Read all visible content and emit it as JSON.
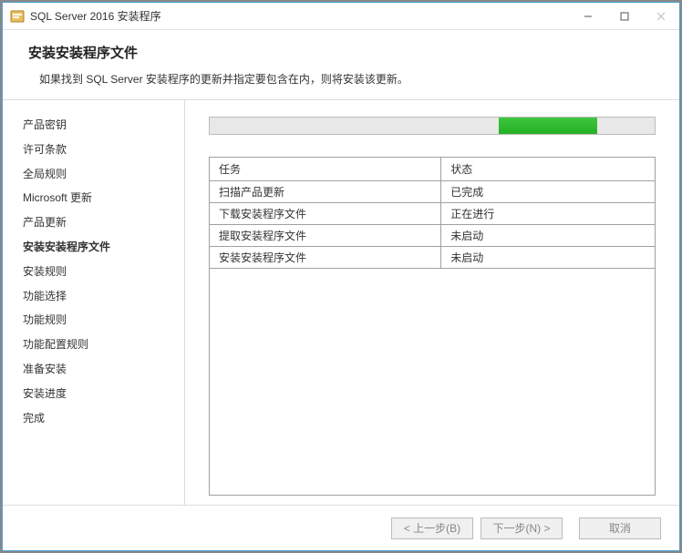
{
  "titlebar": {
    "title": "SQL Server 2016 安装程序"
  },
  "header": {
    "title": "安装安装程序文件",
    "subtitle": "如果找到 SQL Server 安装程序的更新并指定要包含在内，则将安装该更新。"
  },
  "sidebar": {
    "items": [
      {
        "label": "产品密钥",
        "active": false
      },
      {
        "label": "许可条款",
        "active": false
      },
      {
        "label": "全局规则",
        "active": false
      },
      {
        "label": "Microsoft 更新",
        "active": false
      },
      {
        "label": "产品更新",
        "active": false
      },
      {
        "label": "安装安装程序文件",
        "active": true
      },
      {
        "label": "安装规则",
        "active": false
      },
      {
        "label": "功能选择",
        "active": false
      },
      {
        "label": "功能规则",
        "active": false
      },
      {
        "label": "功能配置规则",
        "active": false
      },
      {
        "label": "准备安装",
        "active": false
      },
      {
        "label": "安装进度",
        "active": false
      },
      {
        "label": "完成",
        "active": false
      }
    ]
  },
  "progress": {
    "left_pct": 65,
    "width_pct": 22
  },
  "table": {
    "headers": {
      "task": "任务",
      "status": "状态"
    },
    "rows": [
      {
        "task": "扫描产品更新",
        "status": "已完成"
      },
      {
        "task": "下载安装程序文件",
        "status": "正在进行"
      },
      {
        "task": "提取安装程序文件",
        "status": "未启动"
      },
      {
        "task": "安装安装程序文件",
        "status": "未启动"
      }
    ]
  },
  "footer": {
    "back": "< 上一步(B)",
    "next": "下一步(N) >",
    "cancel": "取消"
  }
}
